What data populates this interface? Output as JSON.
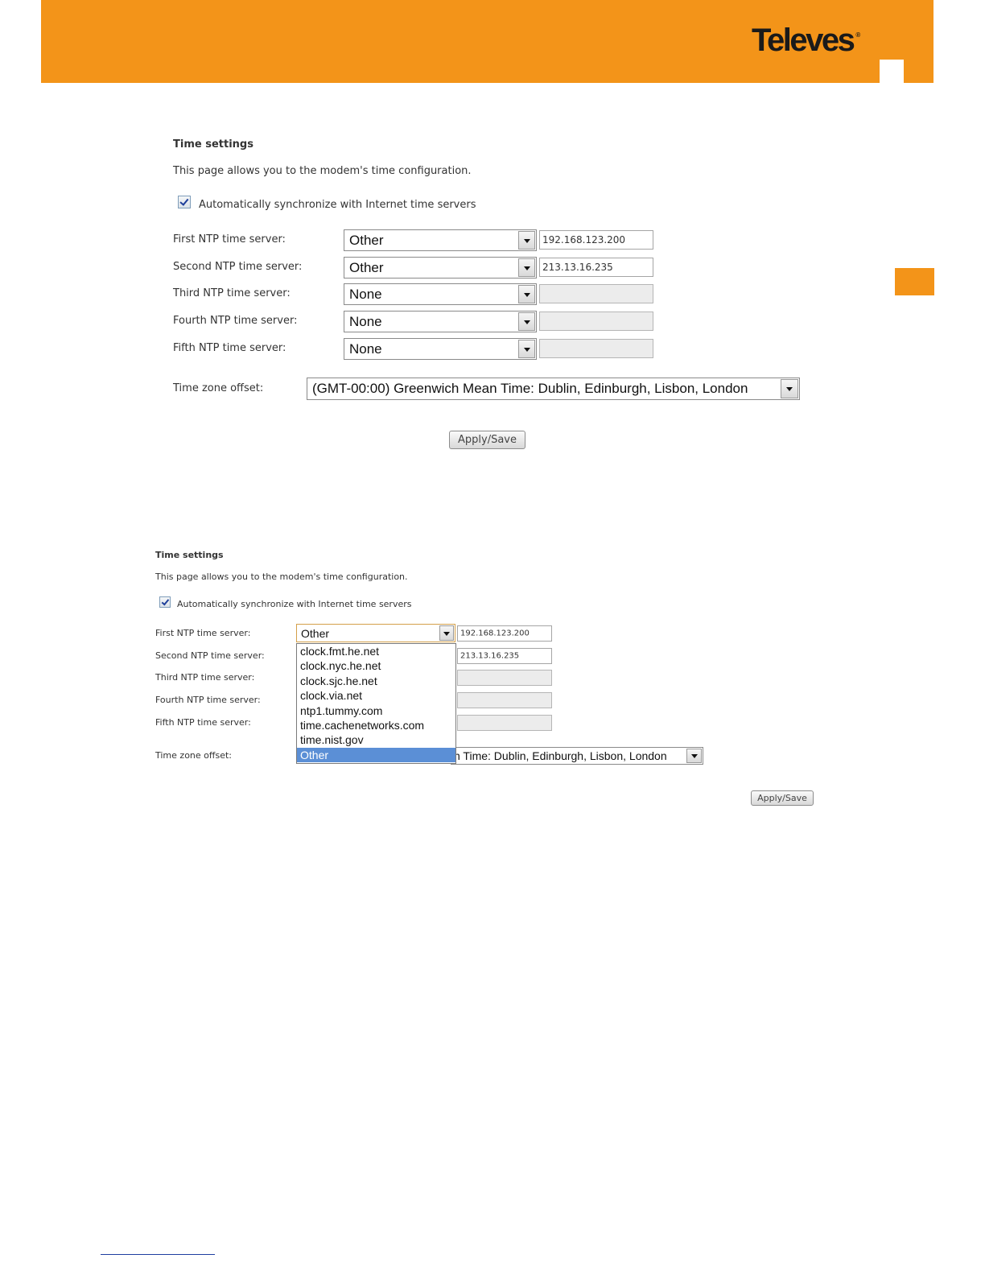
{
  "header": {
    "logo_text": "Televes",
    "logo_mark": "®"
  },
  "time_settings": {
    "title": "Time settings",
    "description": "This page allows you to the modem's time configuration.",
    "auto_sync": {
      "label": "Automatically synchronize with Internet time servers",
      "checked": true
    },
    "ntp_servers": [
      {
        "label": "First NTP time server:",
        "selected": "Other",
        "address": "192.168.123.200"
      },
      {
        "label": "Second NTP time server:",
        "selected": "Other",
        "address": "213.13.16.235"
      },
      {
        "label": "Third NTP time server:",
        "selected": "None",
        "address": ""
      },
      {
        "label": "Fourth NTP time server:",
        "selected": "None",
        "address": ""
      },
      {
        "label": "Fifth NTP time server:",
        "selected": "None",
        "address": ""
      }
    ],
    "timezone": {
      "label": "Time zone offset:",
      "selected": "(GMT-00:00) Greenwich Mean Time: Dublin, Edinburgh, Lisbon, London",
      "partial_visible": "n Time: Dublin, Edinburgh, Lisbon, London"
    },
    "apply_button": "Apply/Save",
    "ntp_options": [
      "clock.fmt.he.net",
      "clock.nyc.he.net",
      "clock.sjc.he.net",
      "clock.via.net",
      "ntp1.tummy.com",
      "time.cachenetworks.com",
      "time.nist.gov",
      "Other"
    ],
    "highlighted_option": "Other"
  },
  "colors": {
    "brand_orange": "#f39419",
    "highlight_blue": "#5b8fd6"
  }
}
